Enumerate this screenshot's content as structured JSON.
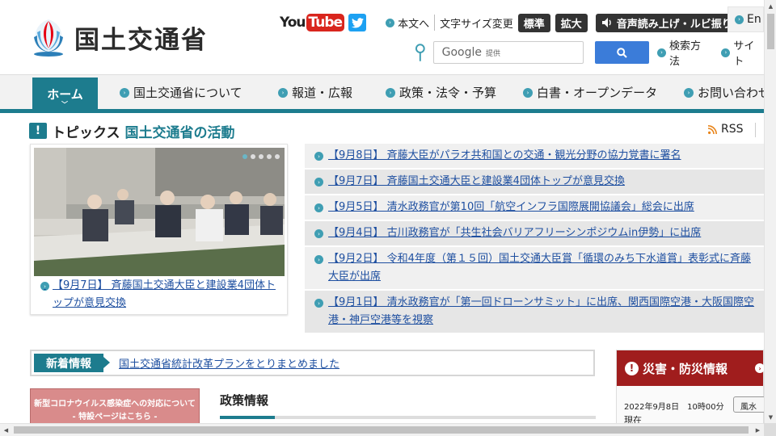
{
  "header": {
    "logo_text": "国土交通省",
    "youtube_you": "You",
    "youtube_tube": "Tube",
    "honbun_label": "本文へ",
    "font_size_label": "文字サイズ変更",
    "font_standard": "標準",
    "font_large": "拡大",
    "voice_label": "音声読み上げ・ルビ振り",
    "lang_label": "En",
    "search_placeholder_brand": "Google",
    "search_placeholder_suffix": "提供",
    "search_method_label": "検索方法",
    "sitemap_label": "サイト"
  },
  "nav": {
    "home": "ホーム",
    "items": [
      "国土交通省について",
      "報道・広報",
      "政策・法令・予算",
      "白書・オープンデータ",
      "お問い合わせ"
    ]
  },
  "topics": {
    "title": "トピックス",
    "subtitle": "国土交通省の活動",
    "rss": "RSS",
    "feature_caption": "【9月7日】 斉藤国土交通大臣と建設業4団体トップが意見交換",
    "items": [
      "【9月8日】 斉藤大臣がパラオ共和国との交通・観光分野の協力覚書に署名",
      "【9月7日】 斉藤国土交通大臣と建設業4団体トップが意見交換",
      "【9月5日】 清水政務官が第10回「航空インフラ国際展開協議会」総会に出席",
      "【9月4日】 古川政務官が「共生社会バリアフリーシンポジウムin伊勢」に出席",
      "【9月2日】 令和4年度（第１５回）国土交通大臣賞「循環のみち下水道賞」表彰式に斉藤大臣が出席",
      "【9月1日】 清水政務官が「第一回ドローンサミット」に出席、関西国際空港・大阪国際空港・神戸空港等を視察"
    ]
  },
  "whats_new": {
    "tag": "新着情報",
    "text": "国土交通省統計改革プランをとりまとめました"
  },
  "covid_banner": {
    "line1": "新型コロナウイルス感染症への対応について",
    "line2": "- 特設ページはこちら -"
  },
  "policy": {
    "title": "政策情報"
  },
  "disaster": {
    "title": "災害・防災情報",
    "date": "2022年9月8日　10時00分",
    "status": "現在",
    "button": "風水"
  },
  "colors": {
    "accent": "#1d7c8e",
    "link": "#1e4fa0",
    "disaster": "#a01d1d",
    "search_button": "#3b7cd9"
  }
}
